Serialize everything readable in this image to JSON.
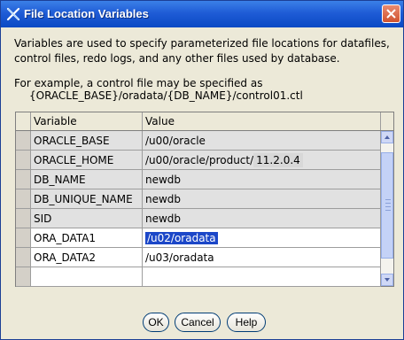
{
  "window": {
    "title": "File Location Variables"
  },
  "description": {
    "line1": "Variables are used to specify parameterized file locations for datafiles, control files, redo logs, and any other files used by database.",
    "example_intro": "For example, a control file may be specified as",
    "example_path": "{ORACLE_BASE}/oradata/{DB_NAME}/control01.ctl"
  },
  "table": {
    "columns": [
      "Variable",
      "Value"
    ],
    "rows": [
      {
        "variable": "ORACLE_BASE",
        "value": "/u00/oracle",
        "editable": false
      },
      {
        "variable": "ORACLE_HOME",
        "value": "/u00/oracle/product/",
        "value_suffix": "11.2.0.4",
        "editable": false
      },
      {
        "variable": "DB_NAME",
        "value": "newdb",
        "editable": false
      },
      {
        "variable": "DB_UNIQUE_NAME",
        "value": "newdb",
        "editable": false
      },
      {
        "variable": "SID",
        "value": "newdb",
        "editable": false
      },
      {
        "variable": "ORA_DATA1",
        "value": "/u02/oradata",
        "editable": true,
        "selected": true
      },
      {
        "variable": "ORA_DATA2",
        "value": "/u03/oradata",
        "editable": true
      },
      {
        "variable": "",
        "value": "",
        "editable": true
      }
    ]
  },
  "buttons": {
    "ok": "OK",
    "cancel": "Cancel",
    "help": "Help"
  },
  "icons": {
    "title": "x-logo-icon",
    "close": "close-icon",
    "scroll_up": "arrow-up-icon",
    "scroll_down": "arrow-down-icon"
  },
  "colors": {
    "titlebar": "#0a49c4",
    "selection": "#1c47c8",
    "dialog_bg": "#ece9d8"
  }
}
